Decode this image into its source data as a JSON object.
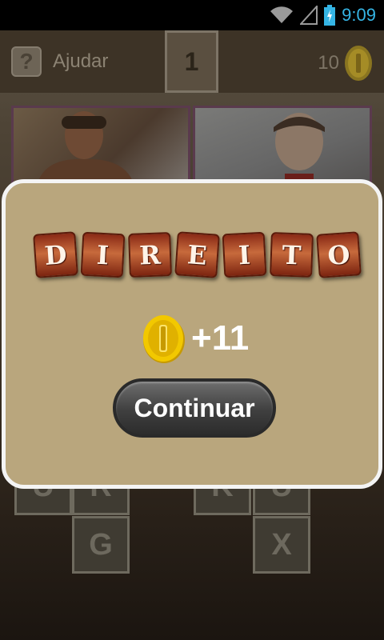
{
  "status_bar": {
    "time": "9:09",
    "icons": [
      "wifi-icon",
      "signal-icon",
      "battery-charging-icon"
    ],
    "time_color": "#35b5e5"
  },
  "header": {
    "help_label": "Ajudar",
    "help_icon": "?",
    "level": "1",
    "coins": "10"
  },
  "letter_tiles": [
    {
      "letter": "U",
      "id": "u"
    },
    {
      "letter": "R",
      "id": "r"
    },
    {
      "letter": "K",
      "id": "k"
    },
    {
      "letter": "U",
      "id": "u-2"
    },
    {
      "letter": "G",
      "id": "g"
    },
    {
      "letter": "X",
      "id": "x"
    }
  ],
  "dialog": {
    "answer_letters": [
      "D",
      "I",
      "R",
      "E",
      "I",
      "T",
      "O"
    ],
    "reward": "+11",
    "continue_label": "Continuar",
    "background_color": "#b9a67d"
  }
}
